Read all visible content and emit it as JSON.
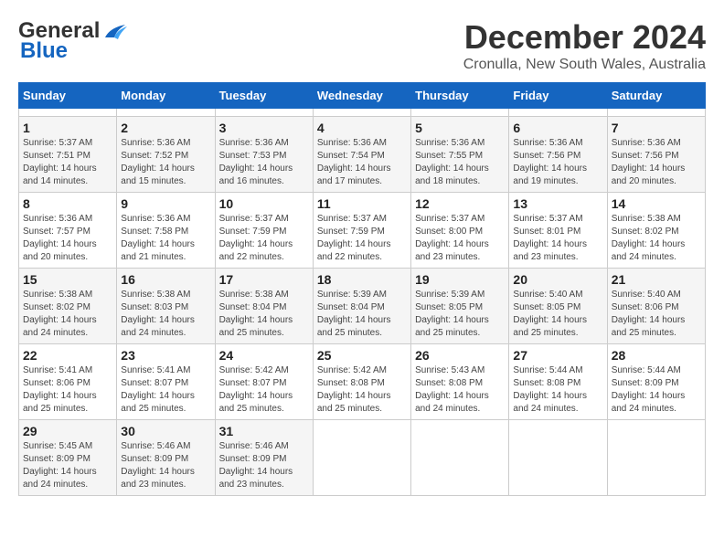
{
  "header": {
    "logo_general": "General",
    "logo_blue": "Blue",
    "month_title": "December 2024",
    "location": "Cronulla, New South Wales, Australia"
  },
  "calendar": {
    "days_of_week": [
      "Sunday",
      "Monday",
      "Tuesday",
      "Wednesday",
      "Thursday",
      "Friday",
      "Saturday"
    ],
    "weeks": [
      [
        null,
        null,
        null,
        null,
        null,
        null,
        null
      ],
      [
        {
          "day": 1,
          "sunrise": "5:37 AM",
          "sunset": "7:51 PM",
          "daylight": "14 hours and 14 minutes"
        },
        {
          "day": 2,
          "sunrise": "5:36 AM",
          "sunset": "7:52 PM",
          "daylight": "14 hours and 15 minutes"
        },
        {
          "day": 3,
          "sunrise": "5:36 AM",
          "sunset": "7:53 PM",
          "daylight": "14 hours and 16 minutes"
        },
        {
          "day": 4,
          "sunrise": "5:36 AM",
          "sunset": "7:54 PM",
          "daylight": "14 hours and 17 minutes"
        },
        {
          "day": 5,
          "sunrise": "5:36 AM",
          "sunset": "7:55 PM",
          "daylight": "14 hours and 18 minutes"
        },
        {
          "day": 6,
          "sunrise": "5:36 AM",
          "sunset": "7:56 PM",
          "daylight": "14 hours and 19 minutes"
        },
        {
          "day": 7,
          "sunrise": "5:36 AM",
          "sunset": "7:56 PM",
          "daylight": "14 hours and 20 minutes"
        }
      ],
      [
        {
          "day": 8,
          "sunrise": "5:36 AM",
          "sunset": "7:57 PM",
          "daylight": "14 hours and 20 minutes"
        },
        {
          "day": 9,
          "sunrise": "5:36 AM",
          "sunset": "7:58 PM",
          "daylight": "14 hours and 21 minutes"
        },
        {
          "day": 10,
          "sunrise": "5:37 AM",
          "sunset": "7:59 PM",
          "daylight": "14 hours and 22 minutes"
        },
        {
          "day": 11,
          "sunrise": "5:37 AM",
          "sunset": "7:59 PM",
          "daylight": "14 hours and 22 minutes"
        },
        {
          "day": 12,
          "sunrise": "5:37 AM",
          "sunset": "8:00 PM",
          "daylight": "14 hours and 23 minutes"
        },
        {
          "day": 13,
          "sunrise": "5:37 AM",
          "sunset": "8:01 PM",
          "daylight": "14 hours and 23 minutes"
        },
        {
          "day": 14,
          "sunrise": "5:38 AM",
          "sunset": "8:02 PM",
          "daylight": "14 hours and 24 minutes"
        }
      ],
      [
        {
          "day": 15,
          "sunrise": "5:38 AM",
          "sunset": "8:02 PM",
          "daylight": "14 hours and 24 minutes"
        },
        {
          "day": 16,
          "sunrise": "5:38 AM",
          "sunset": "8:03 PM",
          "daylight": "14 hours and 24 minutes"
        },
        {
          "day": 17,
          "sunrise": "5:38 AM",
          "sunset": "8:04 PM",
          "daylight": "14 hours and 25 minutes"
        },
        {
          "day": 18,
          "sunrise": "5:39 AM",
          "sunset": "8:04 PM",
          "daylight": "14 hours and 25 minutes"
        },
        {
          "day": 19,
          "sunrise": "5:39 AM",
          "sunset": "8:05 PM",
          "daylight": "14 hours and 25 minutes"
        },
        {
          "day": 20,
          "sunrise": "5:40 AM",
          "sunset": "8:05 PM",
          "daylight": "14 hours and 25 minutes"
        },
        {
          "day": 21,
          "sunrise": "5:40 AM",
          "sunset": "8:06 PM",
          "daylight": "14 hours and 25 minutes"
        }
      ],
      [
        {
          "day": 22,
          "sunrise": "5:41 AM",
          "sunset": "8:06 PM",
          "daylight": "14 hours and 25 minutes"
        },
        {
          "day": 23,
          "sunrise": "5:41 AM",
          "sunset": "8:07 PM",
          "daylight": "14 hours and 25 minutes"
        },
        {
          "day": 24,
          "sunrise": "5:42 AM",
          "sunset": "8:07 PM",
          "daylight": "14 hours and 25 minutes"
        },
        {
          "day": 25,
          "sunrise": "5:42 AM",
          "sunset": "8:08 PM",
          "daylight": "14 hours and 25 minutes"
        },
        {
          "day": 26,
          "sunrise": "5:43 AM",
          "sunset": "8:08 PM",
          "daylight": "14 hours and 24 minutes"
        },
        {
          "day": 27,
          "sunrise": "5:44 AM",
          "sunset": "8:08 PM",
          "daylight": "14 hours and 24 minutes"
        },
        {
          "day": 28,
          "sunrise": "5:44 AM",
          "sunset": "8:09 PM",
          "daylight": "14 hours and 24 minutes"
        }
      ],
      [
        {
          "day": 29,
          "sunrise": "5:45 AM",
          "sunset": "8:09 PM",
          "daylight": "14 hours and 24 minutes"
        },
        {
          "day": 30,
          "sunrise": "5:46 AM",
          "sunset": "8:09 PM",
          "daylight": "14 hours and 23 minutes"
        },
        {
          "day": 31,
          "sunrise": "5:46 AM",
          "sunset": "8:09 PM",
          "daylight": "14 hours and 23 minutes"
        },
        null,
        null,
        null,
        null
      ]
    ]
  }
}
